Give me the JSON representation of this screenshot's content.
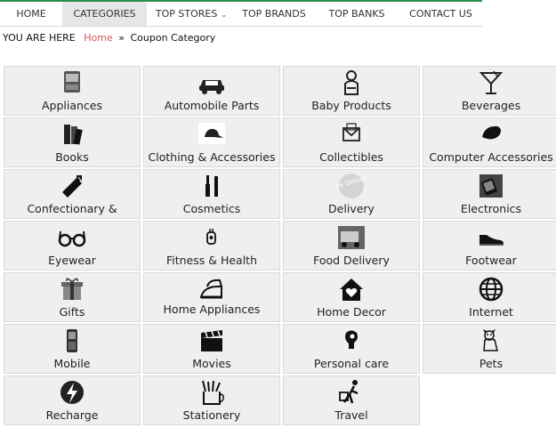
{
  "nav": {
    "items": [
      {
        "label": "HOME"
      },
      {
        "label": "CATEGORIES"
      },
      {
        "label": "TOP STORES",
        "dropdown": "⌄"
      },
      {
        "label": "TOP BRANDS"
      },
      {
        "label": "TOP BANKS"
      },
      {
        "label": "CONTACT US"
      }
    ],
    "active": "CATEGORIES",
    "accent": "#2b8f4e"
  },
  "breadcrumb": {
    "prefix": "YOU ARE HERE",
    "home": "Home",
    "separator": "»",
    "current": "Coupon Category",
    "link_color": "#d9534f"
  },
  "categories": [
    {
      "label": "Appliances",
      "icon": "appliance-icon"
    },
    {
      "label": "Automobile Parts",
      "icon": "car-icon"
    },
    {
      "label": "Baby Products",
      "icon": "baby-icon"
    },
    {
      "label": "Beverages",
      "icon": "cocktail-icon"
    },
    {
      "label": "Books",
      "icon": "books-icon"
    },
    {
      "label": "Clothing & Accessories",
      "icon": "cap-icon"
    },
    {
      "label": "Collectibles",
      "icon": "envelope-icon"
    },
    {
      "label": "Computer Accessories",
      "icon": "mouse-icon"
    },
    {
      "label": "Confectionary & Bakery",
      "icon": "cake-icon"
    },
    {
      "label": "Cosmetics",
      "icon": "cosmetics-icon"
    },
    {
      "label": "Delivery",
      "icon": "free-delivery-icon",
      "icon_text": "Free Delivery"
    },
    {
      "label": "Electronics",
      "icon": "electronics-icon"
    },
    {
      "label": "Eyewear",
      "icon": "glasses-icon"
    },
    {
      "label": "Fitness & Health",
      "icon": "fitness-icon"
    },
    {
      "label": "Food Delivery",
      "icon": "food-delivery-icon"
    },
    {
      "label": "Footwear",
      "icon": "shoe-icon"
    },
    {
      "label": "Gifts",
      "icon": "gift-icon"
    },
    {
      "label": "Home Appliances",
      "icon": "iron-icon"
    },
    {
      "label": "Home Decor",
      "icon": "home-heart-icon"
    },
    {
      "label": "Internet",
      "icon": "globe-icon"
    },
    {
      "label": "Mobile",
      "icon": "mobile-phone-icon"
    },
    {
      "label": "Movies",
      "icon": "clapperboard-icon"
    },
    {
      "label": "Personal care",
      "icon": "personal-care-icon"
    },
    {
      "label": "Pets",
      "icon": "pet-icon"
    },
    {
      "label": "Recharge",
      "icon": "lightning-icon"
    },
    {
      "label": "Stationery",
      "icon": "stationery-icon"
    },
    {
      "label": "Travel",
      "icon": "traveler-icon"
    }
  ]
}
